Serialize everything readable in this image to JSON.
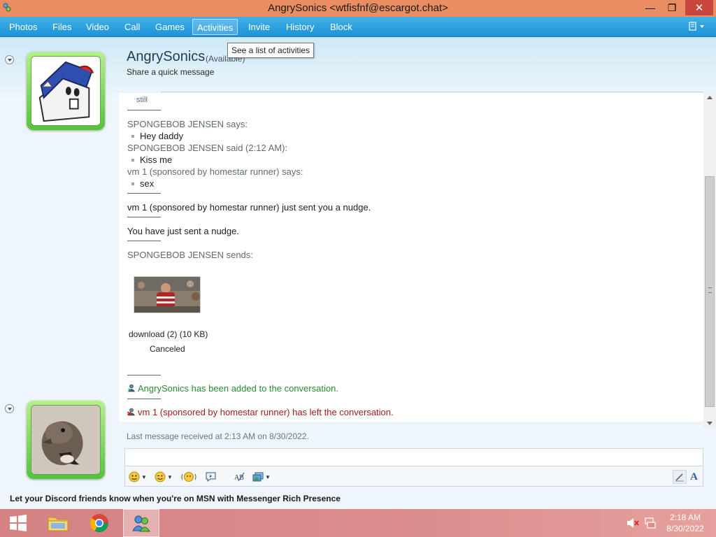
{
  "window": {
    "title": "AngrySonics <wtfisfnf@escargot.chat>",
    "minimize": "—",
    "maximize": "❐",
    "close": "✕"
  },
  "menu": {
    "tabs": [
      "Photos",
      "Files",
      "Video",
      "Call",
      "Games",
      "Activities",
      "Invite",
      "History",
      "Block"
    ],
    "active_tab": "Activities",
    "tooltip": "See a list of activities"
  },
  "contact": {
    "name": "AngrySonics",
    "status": "(Available)",
    "personal_message": "Share a quick message"
  },
  "conversation": {
    "truncated_text": "still",
    "entries": [
      {
        "type": "header",
        "text": "SPONGEBOB JENSEN says:"
      },
      {
        "type": "message",
        "text": "Hey daddy"
      },
      {
        "type": "header",
        "text": "SPONGEBOB JENSEN said (2:12 AM):"
      },
      {
        "type": "message",
        "text": "Kiss me"
      },
      {
        "type": "header",
        "text": "vm 1 (sponsored by homestar runner) says:"
      },
      {
        "type": "message",
        "text": "sex"
      },
      {
        "type": "notice",
        "text": "vm 1 (sponsored by homestar runner) just sent you a nudge."
      },
      {
        "type": "notice",
        "text": "You have just sent a nudge."
      },
      {
        "type": "header",
        "text": "SPONGEBOB JENSEN sends:"
      }
    ],
    "file_transfer": {
      "name": "download (2) (10 KB)",
      "status": "Canceled"
    },
    "joined": "AngrySonics has been added to the conversation.",
    "left": "vm 1 (sponsored by homestar runner) has left the conversation."
  },
  "last_message": "Last message received at 2:13 AM on 8/30/2022.",
  "input": {
    "value": ""
  },
  "promo": "Let your Discord friends know when you're on MSN with Messenger Rich Presence",
  "taskbar": {
    "time": "2:18 AM",
    "date": "8/30/2022"
  },
  "colors": {
    "menu_bar": "#2a9fe0",
    "title_bar": "#e98d63",
    "joined_text": "#2a8a35",
    "left_text": "#9e1a1a"
  }
}
